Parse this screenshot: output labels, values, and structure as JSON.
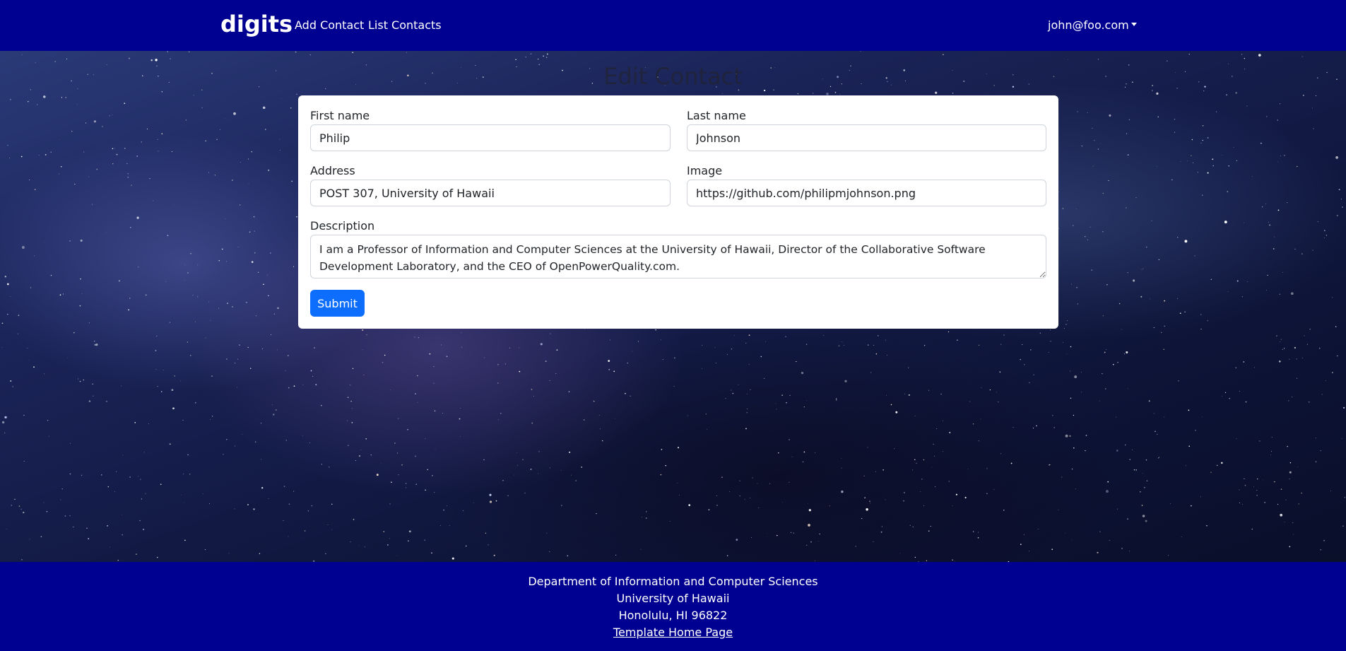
{
  "navbar": {
    "brand": "digits",
    "links": [
      {
        "label": "Add Contact"
      },
      {
        "label": "List Contacts"
      }
    ],
    "user": "john@foo.com"
  },
  "page": {
    "title": "Edit Contact"
  },
  "form": {
    "first_name": {
      "label": "First name",
      "value": "Philip"
    },
    "last_name": {
      "label": "Last name",
      "value": "Johnson"
    },
    "address": {
      "label": "Address",
      "value": "POST 307, University of Hawaii"
    },
    "image": {
      "label": "Image",
      "value": "https://github.com/philipmjohnson.png"
    },
    "description": {
      "label": "Description",
      "value": "I am a Professor of Information and Computer Sciences at the University of Hawaii, Director of the Collaborative Software Development Laboratory, and the CEO of OpenPowerQuality.com."
    },
    "submit_label": "Submit"
  },
  "footer": {
    "line1": "Department of Information and Computer Sciences",
    "line2": "University of Hawaii",
    "line3": "Honolulu, HI 96822",
    "link": "Template Home Page"
  },
  "colors": {
    "navbar": "#000091",
    "primary_button": "#0d6efd",
    "card": "#ffffff"
  }
}
